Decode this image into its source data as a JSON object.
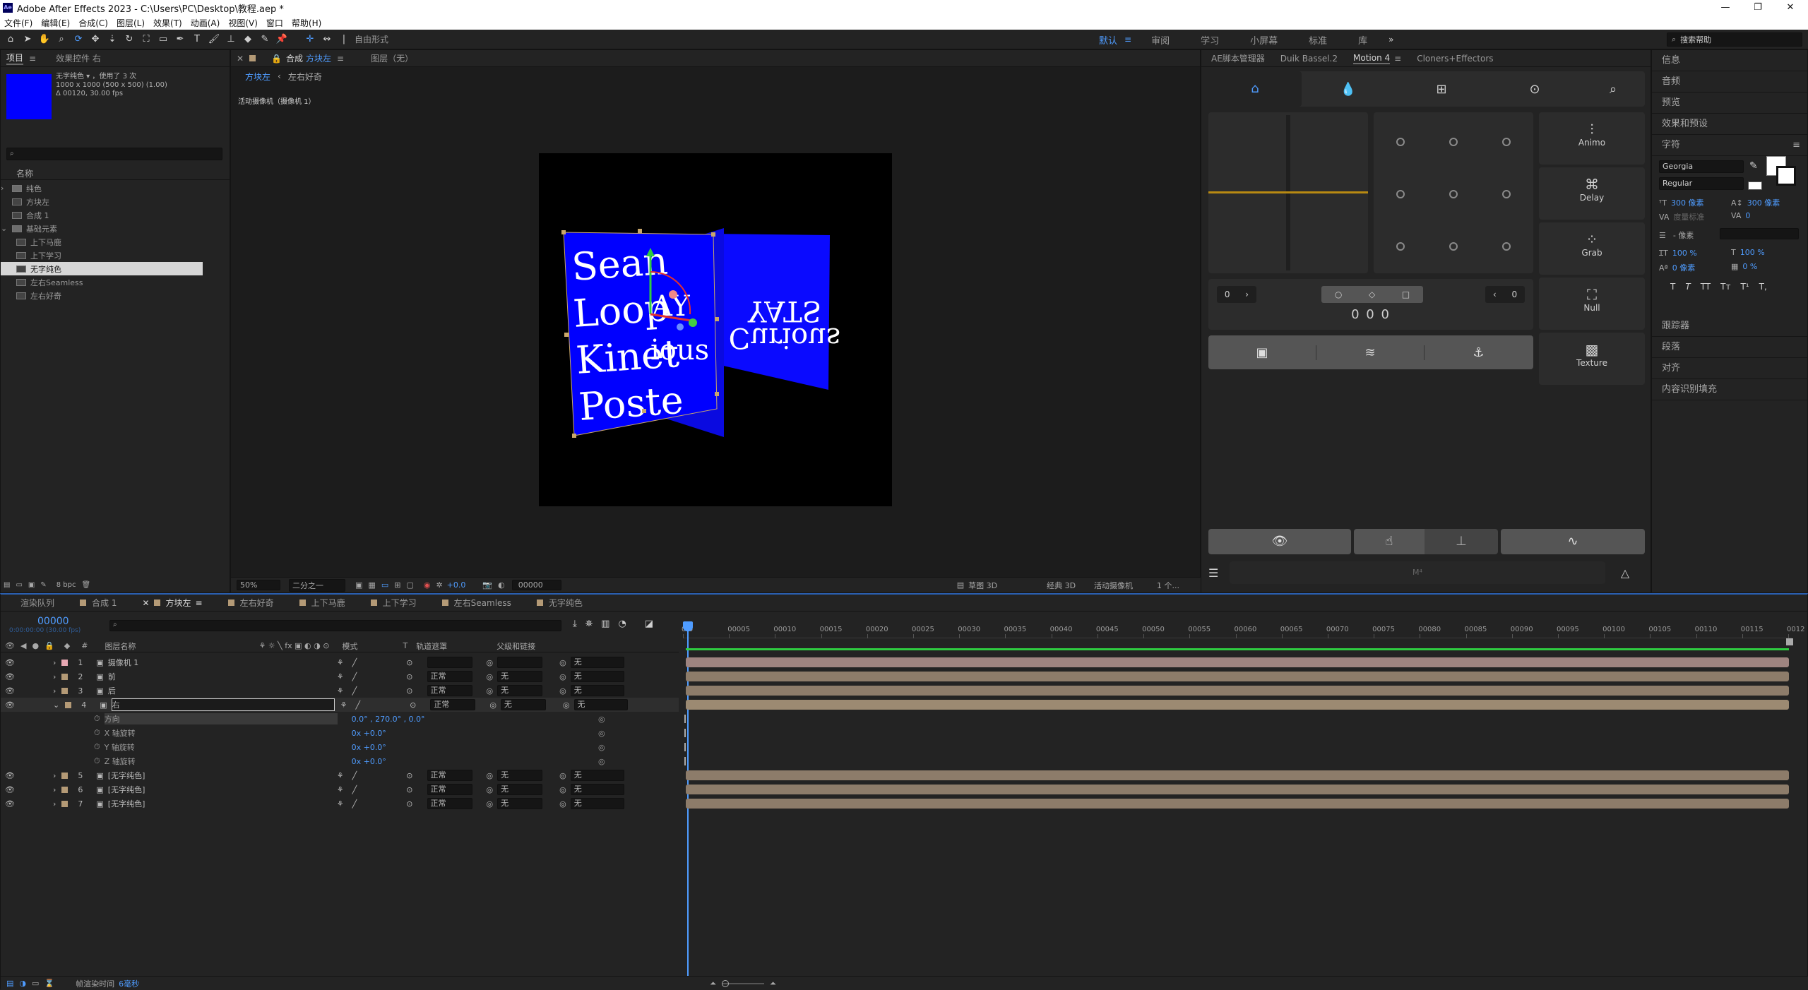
{
  "window": {
    "title": "Adobe After Effects 2023 - C:\\Users\\PC\\Desktop\\教程.aep *",
    "min": "—",
    "max": "❐",
    "close": "✕"
  },
  "menu": [
    "文件(F)",
    "编辑(E)",
    "合成(C)",
    "图层(L)",
    "效果(T)",
    "动画(A)",
    "视图(V)",
    "窗口",
    "帮助(H)"
  ],
  "toolbar": {
    "mode_label": "自由形式",
    "workspaces": [
      "默认",
      "审阅",
      "学习",
      "小屏幕",
      "标准",
      "库"
    ],
    "active_ws": "默认",
    "search_placeholder": "搜索帮助"
  },
  "project": {
    "tabs": [
      "项目",
      "效果控件 右"
    ],
    "item_name": "无字纯色",
    "item_usage": "，使用了 3 次",
    "item_size": "1000 x 1000 (500 x 500) (1.00)",
    "item_duration": "Δ 00120, 30.00 fps",
    "col_name": "名称",
    "tree": [
      {
        "name": "纯色",
        "depth": 0,
        "type": "folder"
      },
      {
        "name": "方块左",
        "depth": 0,
        "type": "comp"
      },
      {
        "name": "合成 1",
        "depth": 0,
        "type": "comp"
      },
      {
        "name": "基础元素",
        "depth": 0,
        "type": "folder"
      },
      {
        "name": "上下马鹿",
        "depth": 1,
        "type": "comp"
      },
      {
        "name": "上下学习",
        "depth": 1,
        "type": "comp"
      },
      {
        "name": "无字纯色",
        "depth": 1,
        "type": "comp",
        "selected": true
      },
      {
        "name": "左右Seamless",
        "depth": 1,
        "type": "comp"
      },
      {
        "name": "左右好奇",
        "depth": 1,
        "type": "comp"
      }
    ],
    "bpc": "8 bpc"
  },
  "comp": {
    "tab_label": "合成",
    "tab_name": "方块左",
    "layer_tab": "图层（无）",
    "nav": [
      "方块左",
      "左右好奇"
    ],
    "camera_label": "活动摄像机（摄像机 1）",
    "front_text": [
      "Sean",
      "Loop",
      "Kinet",
      "Poste"
    ],
    "front_overlay": [
      "AY",
      "ious"
    ],
    "back_text": [
      "YATS",
      "Curious"
    ],
    "zoom": "50%",
    "resolution": "二分之一",
    "exposure": "+0.0",
    "timecode": "00000",
    "draft3d": "草图 3D",
    "renderer": "经典 3D",
    "view": "活动摄像机",
    "views": "1 个..."
  },
  "motion": {
    "tabs": [
      "AE脚本管理器",
      "Duik Bassel.2",
      "Motion 4",
      "Cloners+Effectors"
    ],
    "active_tab": "Motion 4",
    "tools": [
      "Animo",
      "Delay",
      "Grab",
      "Null",
      "Texture"
    ],
    "left_val": "0",
    "right_val": "0",
    "counter": "0 0 0",
    "bottom_label": "M⁴"
  },
  "rightpanel": {
    "sections_top": [
      "信息",
      "音频",
      "预览",
      "效果和预设"
    ],
    "char_title": "字符",
    "font": "Georgia",
    "style": "Regular",
    "size": "300 像素",
    "leading": "300 像素",
    "tracking_label": "度量标准",
    "tracking_val": "0",
    "stroke": "- 像素",
    "vscale": "100 %",
    "hscale": "100 %",
    "baseline": "0 像素",
    "tsume": "0 %",
    "type_btns": [
      "T",
      "T",
      "TT",
      "Tт",
      "T¹",
      "T,"
    ],
    "sections_bottom": [
      "跟踪器",
      "段落",
      "对齐",
      "内容识别填充"
    ]
  },
  "timeline": {
    "tabs": [
      {
        "name": "渲染队列",
        "color": ""
      },
      {
        "name": "合成 1",
        "color": "#b49a76"
      },
      {
        "name": "方块左",
        "color": "#b49a76",
        "active": true
      },
      {
        "name": "左右好奇",
        "color": "#b49a76"
      },
      {
        "name": "上下马鹿",
        "color": "#b49a76"
      },
      {
        "name": "上下学习",
        "color": "#b49a76"
      },
      {
        "name": "左右Seamless",
        "color": "#b49a76"
      },
      {
        "name": "无字纯色",
        "color": "#b49a76"
      }
    ],
    "timecode": "00000",
    "timecode_sub": "0:00:00:00 (30.00 fps)",
    "cols": {
      "num": "#",
      "name": "图层名称",
      "mode": "模式",
      "t": "T",
      "matte": "轨道遮罩",
      "parent": "父级和链接"
    },
    "ruler": [
      "0f0",
      "00005",
      "00010",
      "00015",
      "00020",
      "00025",
      "00030",
      "00035",
      "00040",
      "00045",
      "00050",
      "00055",
      "00060",
      "00065",
      "00070",
      "00075",
      "00080",
      "00085",
      "00090",
      "00095",
      "00100",
      "00105",
      "00110",
      "00115",
      "0012"
    ],
    "layers": [
      {
        "num": "1",
        "name": "摄像机 1",
        "color": "#e8a9b4",
        "mode": "",
        "matte": "",
        "parent": "无",
        "bar": "#9e8480"
      },
      {
        "num": "2",
        "name": "前",
        "color": "#b49a76",
        "mode": "正常",
        "matte": "无",
        "parent": "无",
        "bar": "#8d7c6a"
      },
      {
        "num": "3",
        "name": "后",
        "color": "#b49a76",
        "mode": "正常",
        "matte": "无",
        "parent": "无",
        "bar": "#8d7c6a"
      },
      {
        "num": "4",
        "name": "右",
        "color": "#b49a76",
        "mode": "正常",
        "matte": "无",
        "parent": "无",
        "bar": "#9c8a72",
        "selected": true
      }
    ],
    "props": [
      {
        "name": "方向",
        "value": "0.0° , 270.0° , 0.0°"
      },
      {
        "name": "X 轴旋转",
        "value": "0x +0.0°"
      },
      {
        "name": "Y 轴旋转",
        "value": "0x +0.0°"
      },
      {
        "name": "Z 轴旋转",
        "value": "0x +0.0°"
      }
    ],
    "layers2": [
      {
        "num": "5",
        "name": "[无字纯色]",
        "color": "#b49a76",
        "mode": "正常",
        "matte": "无",
        "parent": "无",
        "bar": "#8d7c6a"
      },
      {
        "num": "6",
        "name": "[无字纯色]",
        "color": "#b49a76",
        "mode": "正常",
        "matte": "无",
        "parent": "无",
        "bar": "#8d7c6a"
      },
      {
        "num": "7",
        "name": "[无字纯色]",
        "color": "#b49a76",
        "mode": "正常",
        "matte": "无",
        "parent": "无",
        "bar": "#8d7c6a"
      }
    ],
    "render_time_label": "帧渲染时间",
    "render_time": "6毫秒"
  }
}
